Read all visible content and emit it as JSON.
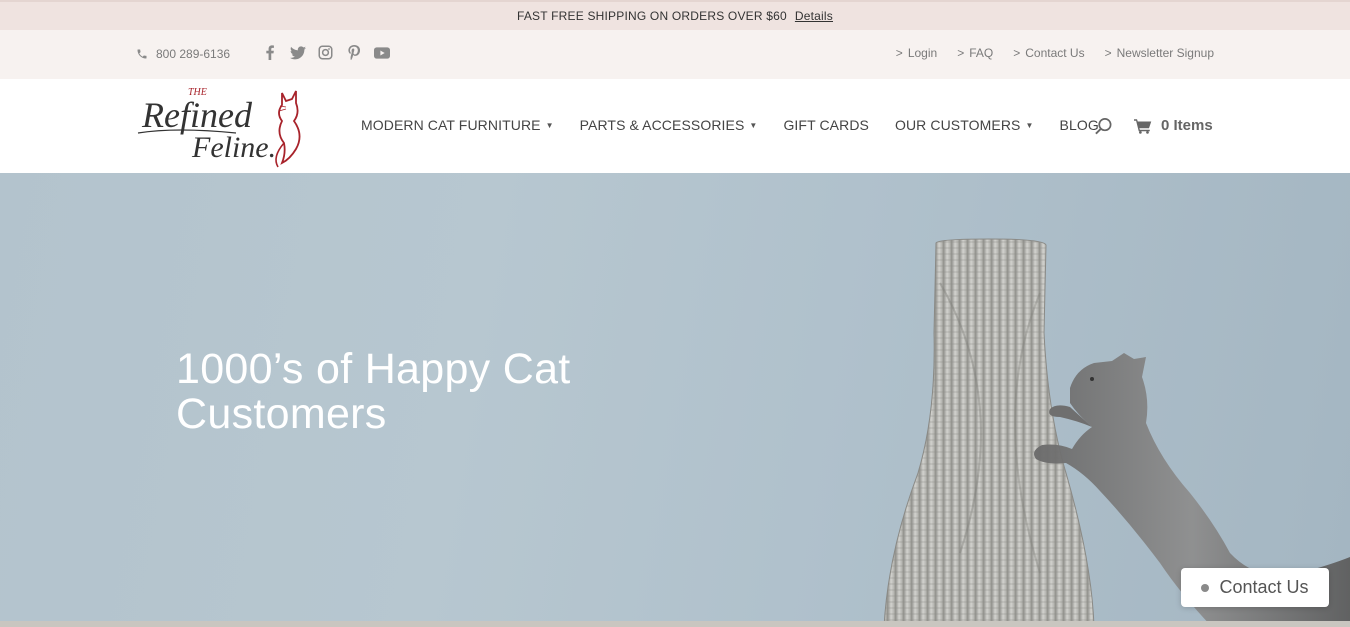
{
  "announcement": {
    "text": "FAST FREE SHIPPING ON ORDERS OVER $60",
    "details_link": "Details"
  },
  "utility_bar": {
    "phone": "800 289-6136",
    "social_icons": [
      "facebook-icon",
      "twitter-icon",
      "instagram-icon",
      "pinterest-icon",
      "youtube-icon"
    ],
    "links": [
      {
        "arrow": ">",
        "label": "Login"
      },
      {
        "arrow": ">",
        "label": "FAQ"
      },
      {
        "arrow": ">",
        "label": "Contact Us"
      },
      {
        "arrow": ">",
        "label": "Newsletter Signup"
      }
    ]
  },
  "header": {
    "logo": {
      "top": "THE",
      "line1": "Refined",
      "line2": "Feline"
    },
    "nav": [
      {
        "label": "MODERN CAT FURNITURE",
        "caret": "▼"
      },
      {
        "label": "PARTS & ACCESSORIES",
        "caret": "▼"
      },
      {
        "label": "GIFT CARDS"
      },
      {
        "label": "OUR CUSTOMERS",
        "caret": "▼"
      },
      {
        "label": "BLOG"
      }
    ],
    "cart_label": "0 Items"
  },
  "hero": {
    "headline_line1": "1000’s of Happy Cat",
    "headline_line2": "Customers"
  },
  "contact_widget": {
    "label": "Contact Us"
  },
  "colors": {
    "announce_bg": "#efe3e0",
    "utility_bg": "#f7f2f0",
    "hero_bg": "#b3c3cd",
    "logo_accent": "#a8232b"
  }
}
